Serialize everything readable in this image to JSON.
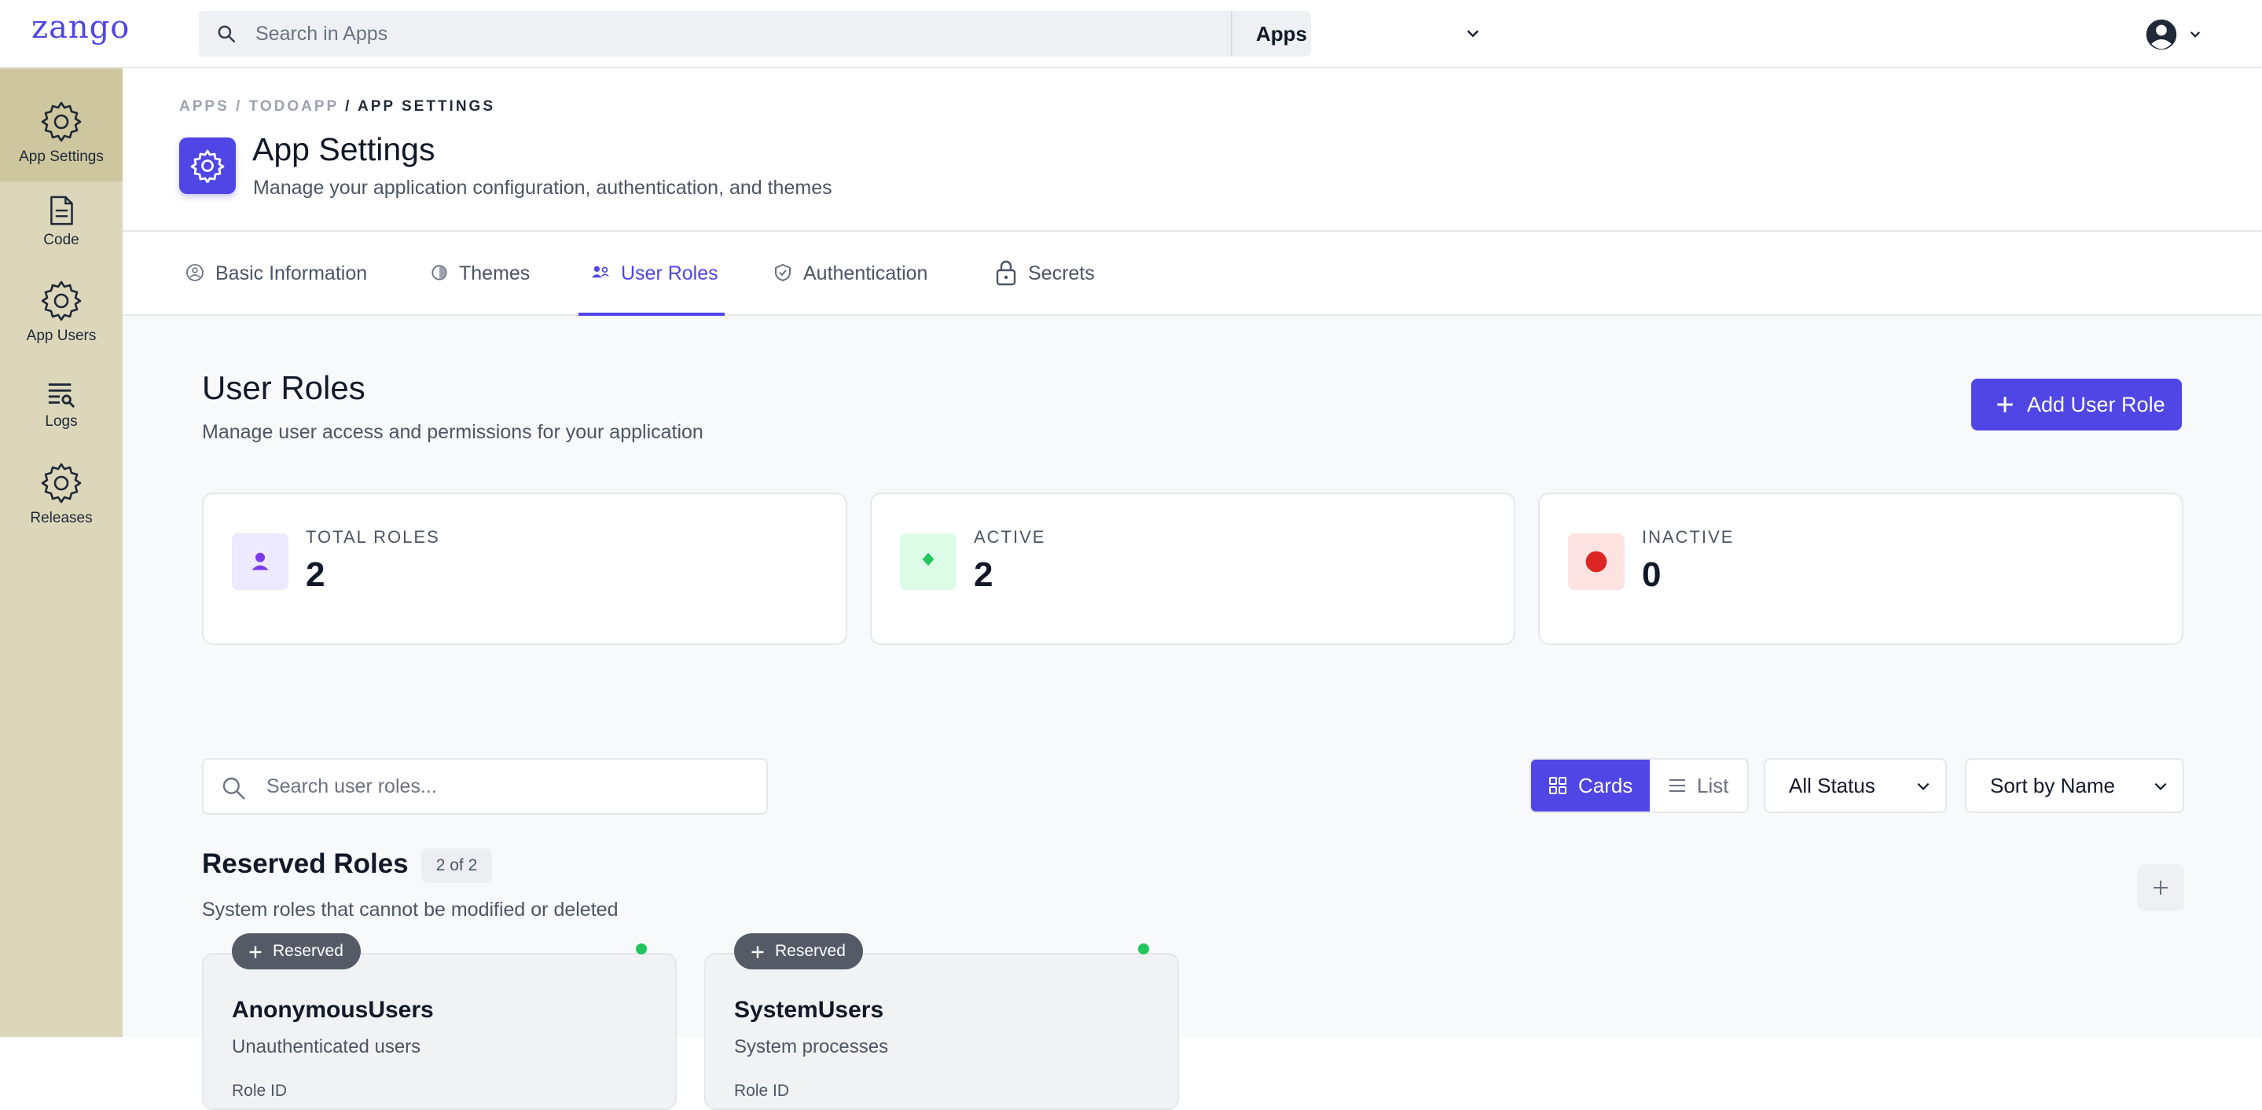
{
  "app": {
    "logo": "zango"
  },
  "topbar": {
    "search_placeholder": "Search in Apps",
    "app_selector": "Apps"
  },
  "sidebar": {
    "items": [
      {
        "label": "App Settings",
        "icon": "gear-icon",
        "active": true
      },
      {
        "label": "Code",
        "icon": "file-icon"
      },
      {
        "label": "App Users",
        "icon": "gear-icon"
      },
      {
        "label": "Logs",
        "icon": "logs-icon"
      },
      {
        "label": "Releases",
        "icon": "gear-icon"
      }
    ]
  },
  "header": {
    "breadcrumb": [
      "APPS",
      "TODOAPP",
      "APP SETTINGS"
    ],
    "breadcrumb_sep": " / ",
    "title": "App Settings",
    "subtitle": "Manage your application configuration, authentication, and themes"
  },
  "tabs": [
    {
      "label": "Basic Information",
      "icon": "info-circle-icon"
    },
    {
      "label": "Themes",
      "icon": "palette-icon"
    },
    {
      "label": "User Roles",
      "icon": "user-roles-icon",
      "active": true
    },
    {
      "label": "Authentication",
      "icon": "shield-icon"
    },
    {
      "label": "Secrets",
      "icon": "lock-icon"
    }
  ],
  "roles_page": {
    "title": "User Roles",
    "subtitle": "Manage user access and permissions for your application",
    "add_button": "Add User Role"
  },
  "stats": [
    {
      "label": "TOTAL ROLES",
      "value": "2",
      "color": "#7c3aed"
    },
    {
      "label": "ACTIVE",
      "value": "2",
      "color": "#22c55e"
    },
    {
      "label": "INACTIVE",
      "value": "0",
      "color": "#dc2626"
    }
  ],
  "filters": {
    "search_placeholder": "Search user roles...",
    "view_cards": "Cards",
    "view_list": "List",
    "status": "All Status",
    "sort": "Sort by Name"
  },
  "reserved": {
    "title": "Reserved Roles",
    "count_badge": "2 of 2",
    "subtitle": "System roles that cannot be modified or deleted",
    "roles": [
      {
        "badge": "Reserved",
        "name": "AnonymousUsers",
        "description": "Unauthenticated users",
        "id_label": "Role ID"
      },
      {
        "badge": "Reserved",
        "name": "SystemUsers",
        "description": "System processes",
        "id_label": "Role ID"
      }
    ]
  },
  "colors": {
    "accent": "#4f46e5",
    "sidebar": "#dcd7bb",
    "sidebar_active": "#cdc69e"
  }
}
